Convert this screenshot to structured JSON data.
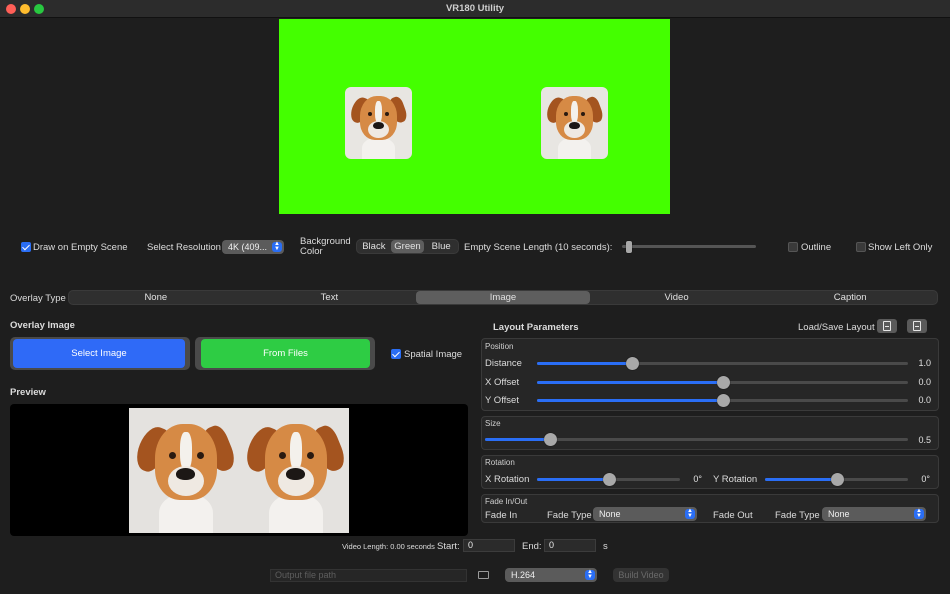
{
  "window": {
    "title": "VR180 Utility"
  },
  "top_controls": {
    "draw_on_empty_scene": {
      "label": "Draw on Empty Scene",
      "checked": true
    },
    "select_resolution": {
      "label": "Select Resolution",
      "value": "4K (409..."
    },
    "background_color": {
      "label_line1": "Background",
      "label_line2": "Color",
      "options": [
        "Black",
        "Green",
        "Blue"
      ],
      "selected": "Green"
    },
    "empty_scene_length": {
      "label": "Empty Scene Length (10 seconds):"
    },
    "outline": {
      "label": "Outline",
      "checked": false
    },
    "show_left_only": {
      "label": "Show Left Only",
      "checked": false
    }
  },
  "overlay_type": {
    "label": "Overlay Type",
    "options": [
      "None",
      "Text",
      "Image",
      "Video",
      "Caption"
    ],
    "selected": "Image"
  },
  "overlay_image": {
    "heading": "Overlay Image",
    "select_image_label": "Select Image",
    "from_files_label": "From Files",
    "spatial_image": {
      "label": "Spatial Image",
      "checked": true
    }
  },
  "preview": {
    "heading": "Preview"
  },
  "layout": {
    "heading": "Layout Parameters",
    "load_save_label": "Load/Save Layout",
    "position": {
      "title": "Position",
      "distance": {
        "label": "Distance",
        "value": "1.0",
        "fraction": 0.257
      },
      "x_offset": {
        "label": "X Offset",
        "value": "0.0",
        "fraction": 0.5
      },
      "y_offset": {
        "label": "Y Offset",
        "value": "0.0",
        "fraction": 0.5
      }
    },
    "size": {
      "title": "Size",
      "value": "0.5",
      "fraction": 0.153
    },
    "rotation": {
      "title": "Rotation",
      "x": {
        "label": "X Rotation",
        "value": "0°",
        "fraction": 0.5
      },
      "y": {
        "label": "Y Rotation",
        "value": "0°",
        "fraction": 0.5
      }
    },
    "fade": {
      "title": "Fade In/Out",
      "fade_in_label": "Fade In",
      "fade_out_label": "Fade Out",
      "fade_type_label": "Fade Type",
      "fade_in_type": "None",
      "fade_out_type": "None"
    }
  },
  "timing": {
    "video_length": "Video Length: 0.00 seconds",
    "start_label": "Start:",
    "start_value": "0",
    "end_label": "End:",
    "end_value": "0",
    "unit": "s"
  },
  "output": {
    "path_placeholder": "Output file path",
    "codec": "H.264",
    "build_label": "Build Video"
  },
  "colors": {
    "accent": "#2a6ef5",
    "scene_background": "#44ff00",
    "select_image_button": "#2f6af7",
    "from_files_button": "#2ecc44"
  }
}
